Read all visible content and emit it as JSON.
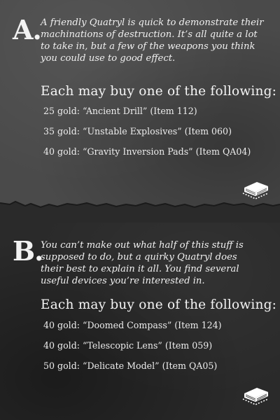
{
  "section_a": {
    "letter": "A.",
    "intro": "A friendly Quatryl is quick to demonstrate their machinations of destruction. It’s all quite a lot to take in, but a few of the weapons you think you could use to good effect.",
    "heading": "Each may buy one of the following:",
    "items": [
      "25 gold: “Ancient Drill” (Item 112)",
      "35 gold: “Unstable Explosives” (Item 060)",
      "40 gold: “Gravity Inversion Pads” (Item QA04)"
    ]
  },
  "section_b": {
    "letter": "B.",
    "intro": "You can’t make out what half of this stuff is supposed to do, but a quirky Quatryl does their best to explain it all. You find several useful devices you’re interested in.",
    "heading": "Each may buy one of the following:",
    "items": [
      "40 gold: “Doomed Compass” (Item 124)",
      "40 gold: “Telescopic Lens” (Item 059)",
      "50 gold: “Delicate Model” (Item QA05)"
    ]
  },
  "icons": [
    "scenario-book-icon",
    "scenario-book-icon"
  ],
  "colors": {
    "top_panel": "#4a4a4a",
    "bottom_panel": "#2a2a2a",
    "text": "#ececec"
  }
}
